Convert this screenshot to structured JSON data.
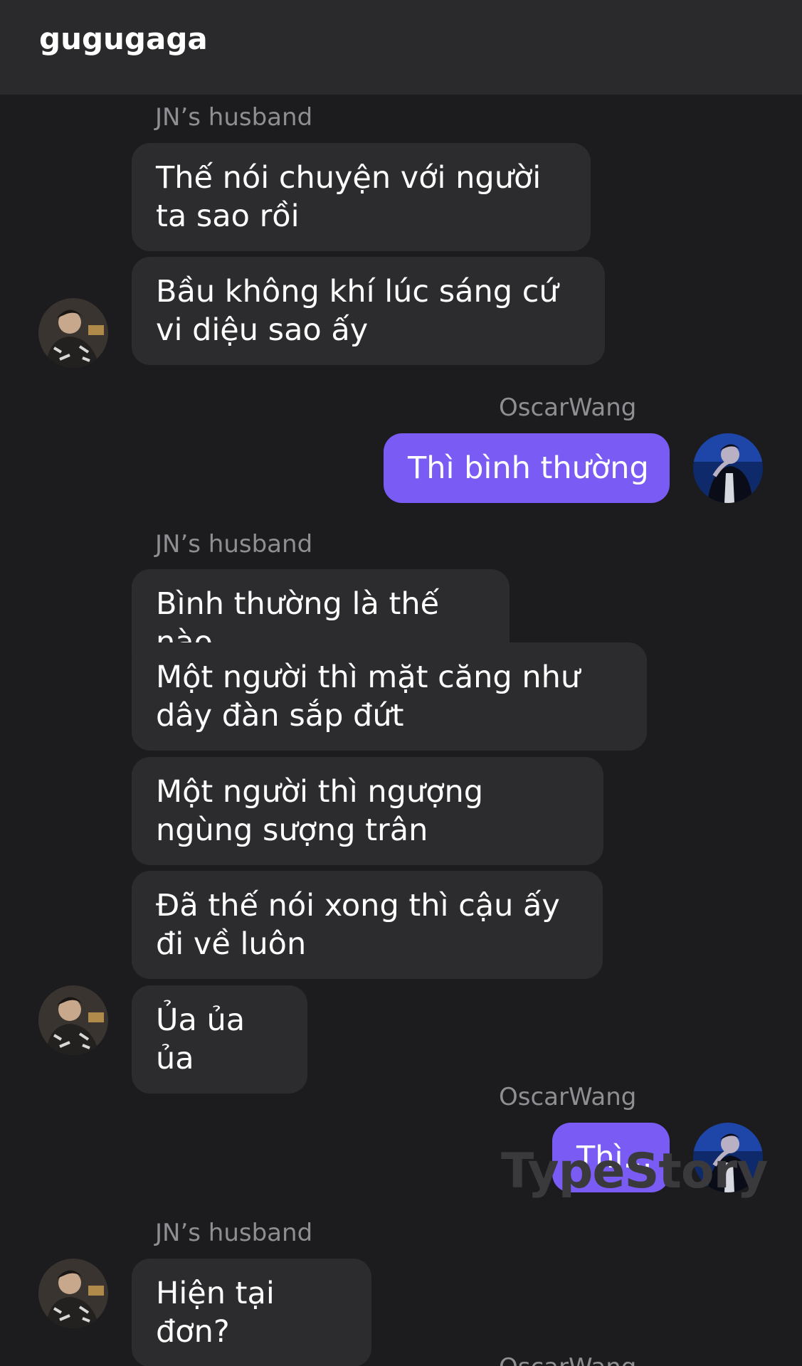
{
  "header": {
    "title": "gugugaga"
  },
  "watermark": "TypeStory",
  "messages": {
    "g1_sender": "JN’s husband",
    "g1_b1": "Thế nói chuyện với người ta sao rồi",
    "g1_b2": "Bầu không khí lúc sáng cứ vi diệu sao ấy",
    "o1_sender": "OscarWang",
    "o1_b1": "Thì bình thường",
    "g2_sender": "JN’s husband",
    "g2_b1": "Bình thường là thế nào",
    "g2_b2": "Một người thì mặt căng như dây đàn sắp đứt",
    "g2_b3": "Một người thì ngượng ngùng sượng trân",
    "g2_b4": "Đã thế nói xong thì cậu ấy đi về luôn",
    "g2_b5": "Ủa ủa ủa",
    "o2_sender": "OscarWang",
    "o2_b1": "Thì...",
    "g3_sender": "JN’s husband",
    "g3_b1": "Hiện tại đơn?",
    "o3_sender": "OscarWang"
  },
  "colors": {
    "background": "#1c1c1e",
    "header": "#2a2a2c",
    "incoming_bubble": "#2c2c2e",
    "outgoing_bubble": "#7a5cf5",
    "sender_label": "#8e8e93"
  }
}
